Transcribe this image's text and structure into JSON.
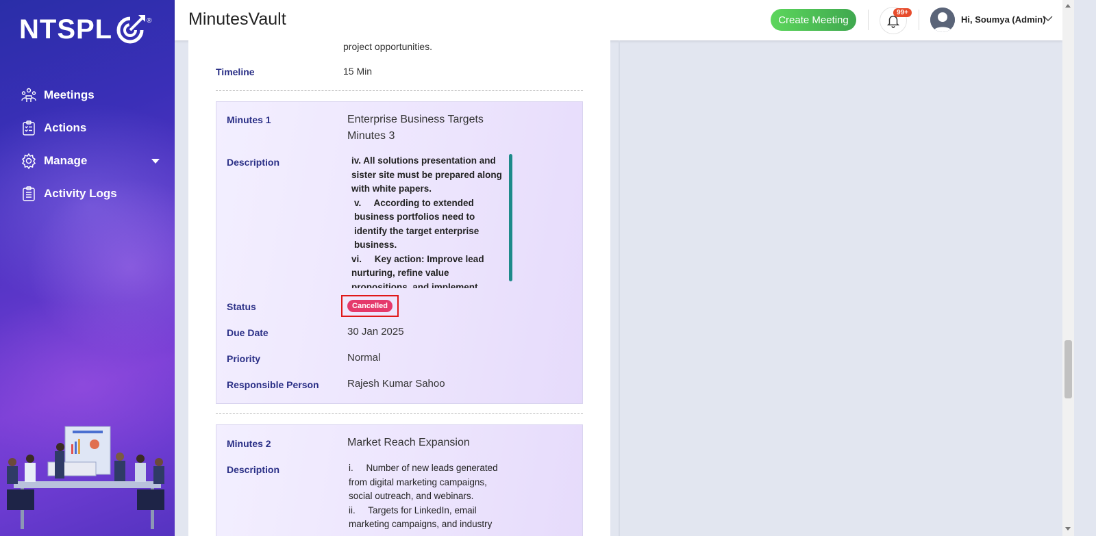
{
  "sidebar": {
    "logo": "NTSPL",
    "items": [
      {
        "label": "Meetings",
        "icon": "meetings-icon"
      },
      {
        "label": "Actions",
        "icon": "clipboard-icon"
      },
      {
        "label": "Manage",
        "icon": "gear-icon"
      },
      {
        "label": "Activity Logs",
        "icon": "clipboard-list-icon"
      }
    ]
  },
  "header": {
    "title": "MinutesVault",
    "create_button": "Create Meeting",
    "notification_badge": "99+",
    "user_greeting": "Hi, Soumya (Admin)"
  },
  "main": {
    "top_text": "project opportunities.",
    "timeline_label": "Timeline",
    "timeline_value": "15 Min",
    "minutes": [
      {
        "label": "Minutes 1",
        "title_line1": "Enterprise Business Targets",
        "title_line2": "Minutes 3",
        "description_label": "Description",
        "description_lines": [
          "iv. All solutions presentation and sister site must be prepared along with white papers.",
          "v.     According to extended business portfolios need to identify the target enterprise business.",
          "vi.     Key action: Improve lead nurturing, refine value propositions, and implement targeted marketing to enterprise segments."
        ],
        "status_label": "Status",
        "status_value": "Cancelled",
        "due_label": "Due Date",
        "due_value": "30 Jan 2025",
        "priority_label": "Priority",
        "priority_value": "Normal",
        "responsible_label": "Responsible Person",
        "responsible_value": "Rajesh Kumar Sahoo"
      },
      {
        "label": "Minutes 2",
        "title_line1": "Market Reach Expansion",
        "description_label": "Description",
        "description_lines": [
          "i.     Number of new leads generated from digital marketing campaigns, social outreach, and webinars.",
          "ii.     Targets for LinkedIn, email marketing campaigns, and industry"
        ]
      }
    ]
  },
  "colors": {
    "accent": "#2a2f86",
    "status_cancelled": "#e5396b",
    "create_button": "#4cbb55"
  }
}
